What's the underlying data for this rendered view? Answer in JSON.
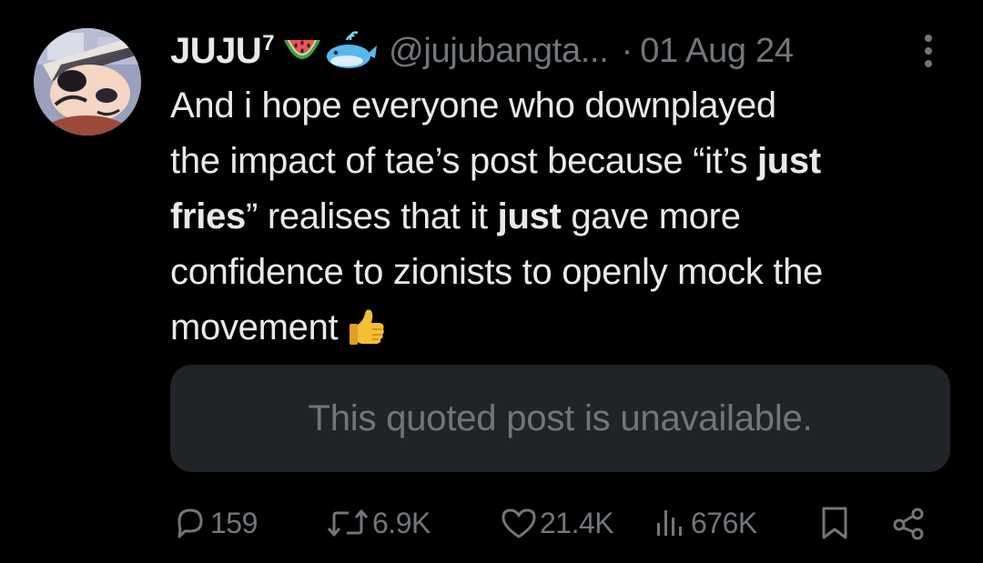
{
  "post": {
    "author": {
      "display_name": "JUJU",
      "name_superscript": "7",
      "emojis": [
        "watermelon-icon",
        "whale-icon"
      ],
      "handle": "@jujubangta...",
      "separator": "·",
      "date": "01 Aug 24"
    },
    "text_lines": [
      [
        {
          "t": "And i hope everyone who downplayed",
          "bold": false
        }
      ],
      [
        {
          "t": "the impact of tae’s post because “it’s ",
          "bold": false
        },
        {
          "t": "just",
          "bold": true
        }
      ],
      [
        {
          "t": "fries",
          "bold": true
        },
        {
          "t": "” realises that it ",
          "bold": false
        },
        {
          "t": "just",
          "bold": true
        },
        {
          "t": " gave more",
          "bold": false
        }
      ],
      [
        {
          "t": "confidence to zionists to openly mock the",
          "bold": false
        }
      ],
      [
        {
          "t": "movement",
          "bold": false
        }
      ]
    ],
    "trailing_emoji": "thumbs-up-icon",
    "quoted_post": {
      "text": "This quoted post is unavailable."
    },
    "stats": {
      "replies": "159",
      "reposts": "6.9K",
      "likes": "21.4K",
      "views": "676K"
    }
  },
  "colors": {
    "background": "#000000",
    "text_primary": "#e7e9ea",
    "text_secondary": "#71767b",
    "quote_background": "#202327"
  }
}
